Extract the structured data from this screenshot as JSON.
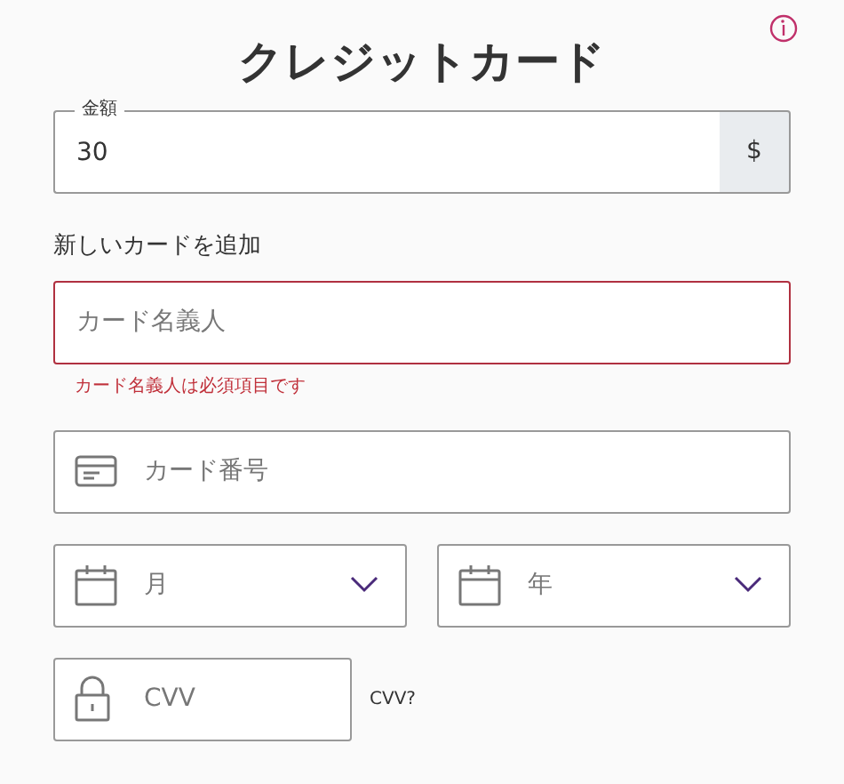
{
  "title": "クレジットカード",
  "amount": {
    "label": "金額",
    "value": "30",
    "suffix": "$"
  },
  "section_label": "新しいカードを追加",
  "fields": [
    {
      "kind": "text",
      "placeholder": "カード名義人",
      "invalid": true,
      "error": "カード名義人は必須項目です"
    },
    {
      "kind": "card",
      "placeholder": "カード番号",
      "invalid": false
    }
  ],
  "expiry": [
    {
      "kind": "select",
      "placeholder": "月"
    },
    {
      "kind": "select",
      "placeholder": "年"
    }
  ],
  "cvv": {
    "placeholder": "CVV",
    "help": "CVV?"
  }
}
